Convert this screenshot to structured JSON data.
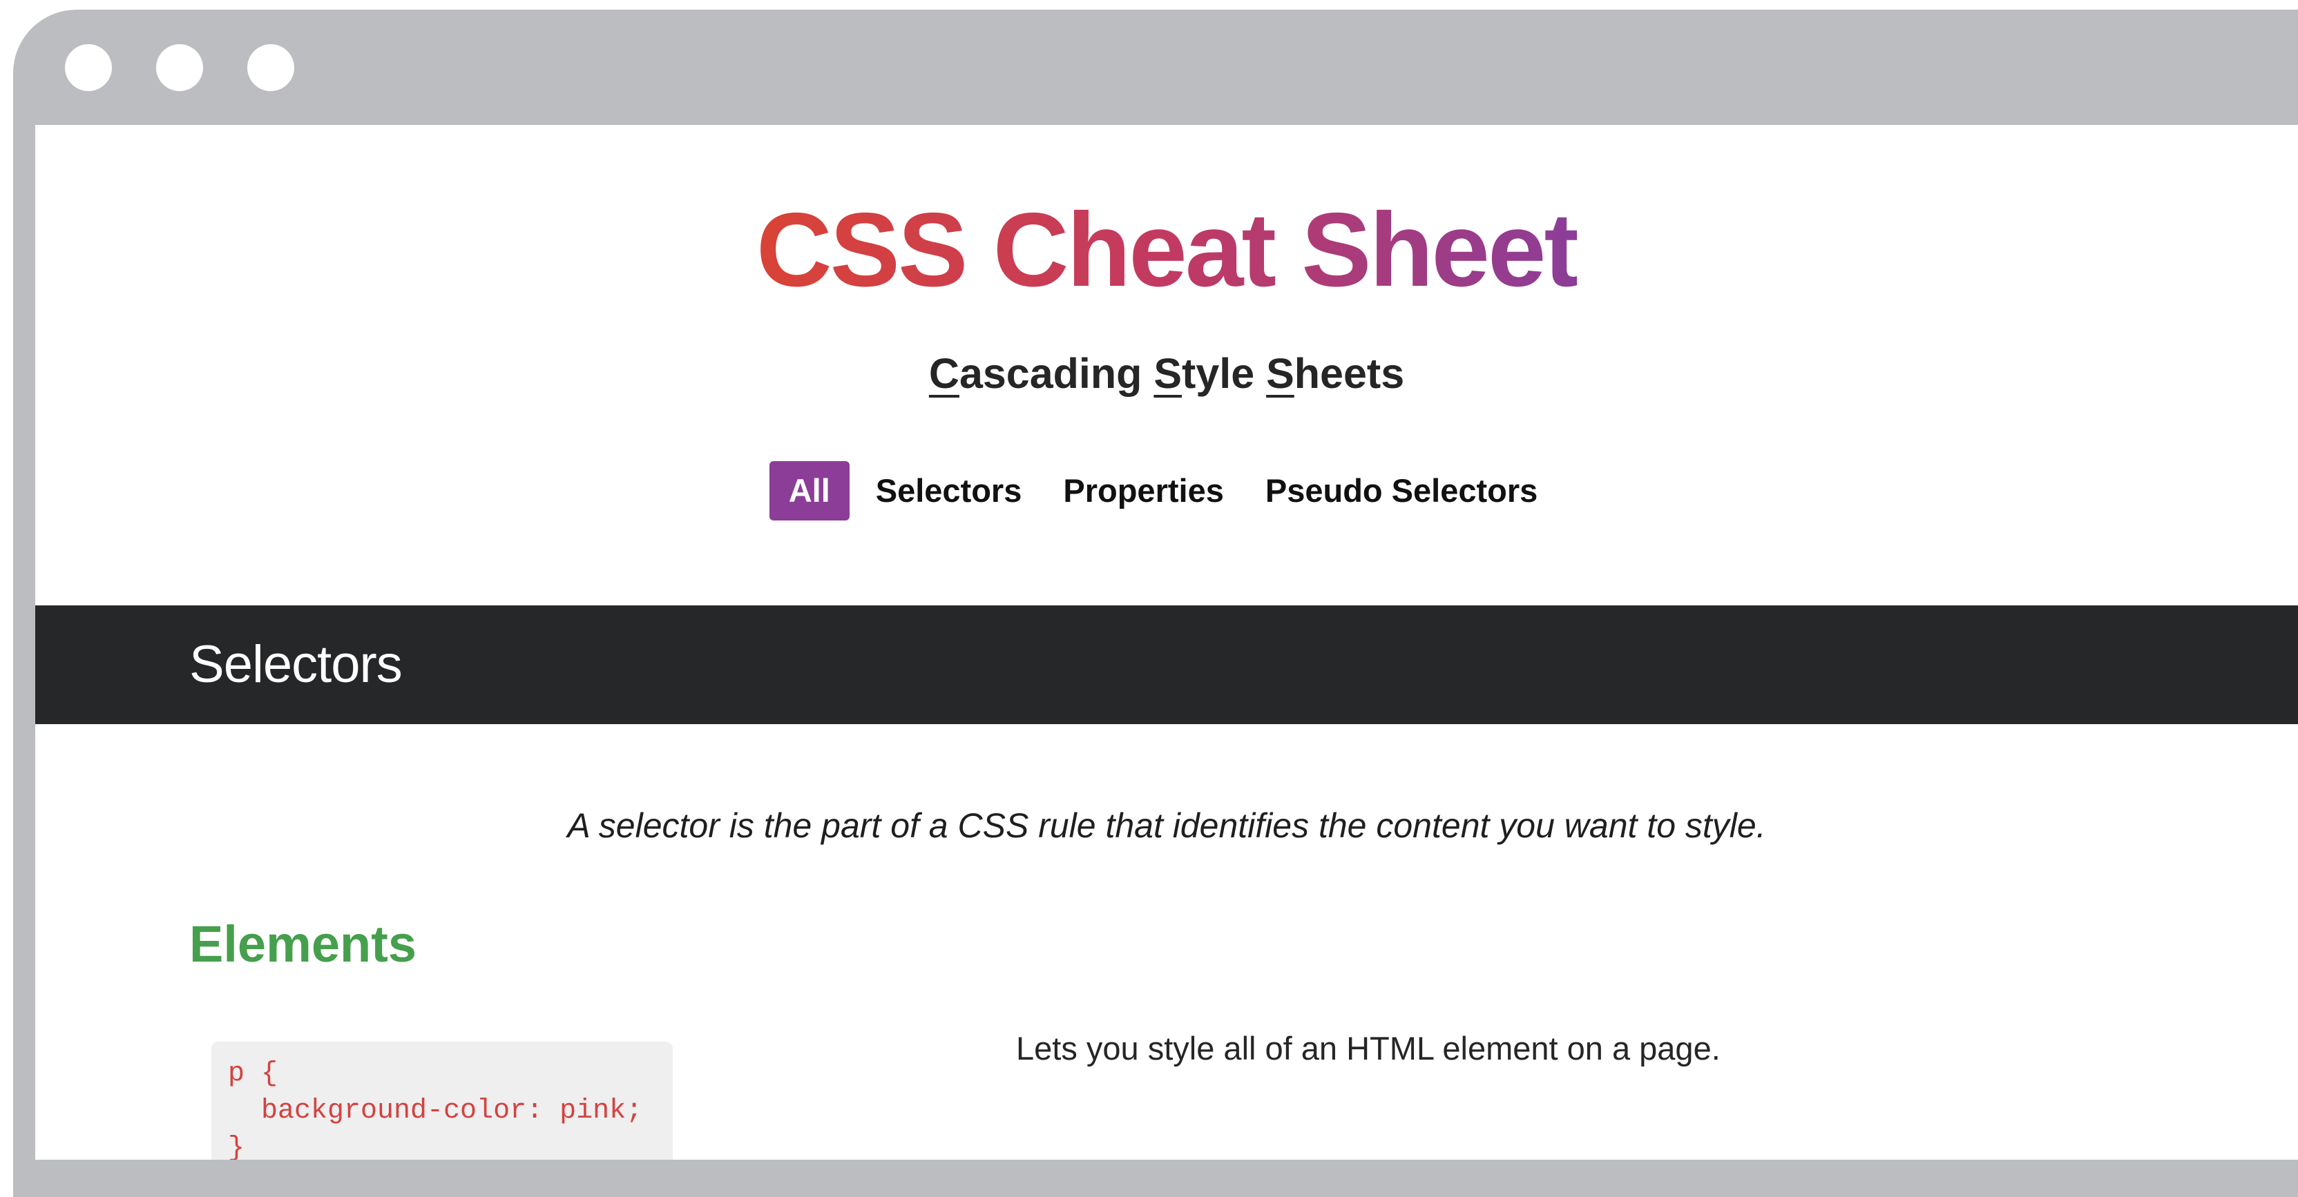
{
  "browser": {
    "window_controls": [
      "close-dot",
      "minimize-dot",
      "maximize-dot"
    ]
  },
  "header": {
    "title": "CSS Cheat Sheet",
    "title_gradient": [
      "#d94336",
      "#8c3d98"
    ],
    "subtitle_parts": [
      "C",
      "ascading ",
      "S",
      "tyle ",
      "S",
      "heets"
    ]
  },
  "nav": {
    "items": [
      {
        "label": "All",
        "active": true
      },
      {
        "label": "Selectors",
        "active": false
      },
      {
        "label": "Properties",
        "active": false
      },
      {
        "label": "Pseudo Selectors",
        "active": false
      }
    ],
    "active_color": "#8b3d97"
  },
  "section": {
    "title": "Selectors",
    "bar_color": "#262728",
    "description": "A selector is the part of a CSS rule that identifies the content you want to style."
  },
  "elements": {
    "heading": "Elements",
    "heading_color": "#459f4c",
    "code": "p {\n  background-color: pink;\n}",
    "code_color": "#d3423f",
    "description": "Lets you style all of an HTML element on a page."
  }
}
